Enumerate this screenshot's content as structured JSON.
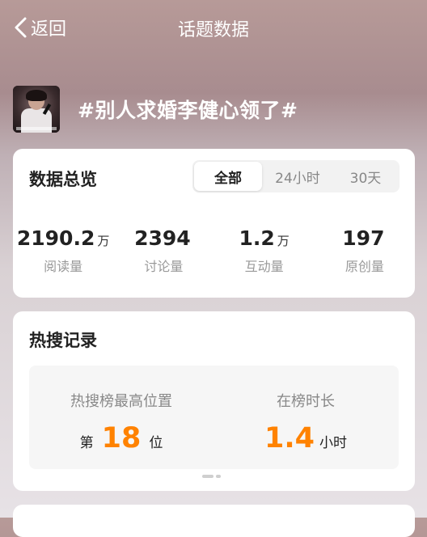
{
  "nav": {
    "back_label": "返回",
    "title": "话题数据"
  },
  "topic": {
    "name": "#别人求婚李健心领了#"
  },
  "overview": {
    "title": "数据总览",
    "tabs": [
      "全部",
      "24小时",
      "30天"
    ],
    "active_tab": "全部",
    "stats": [
      {
        "value": "2190.2",
        "unit": "万",
        "label": "阅读量"
      },
      {
        "value": "2394",
        "unit": "",
        "label": "讨论量"
      },
      {
        "value": "1.2",
        "unit": "万",
        "label": "互动量"
      },
      {
        "value": "197",
        "unit": "",
        "label": "原创量"
      }
    ]
  },
  "hot": {
    "title": "热搜记录",
    "peak": {
      "label": "热搜榜最高位置",
      "prefix": "第",
      "value": "18",
      "suffix": "位"
    },
    "duration": {
      "label": "在榜时长",
      "value": "1.4",
      "suffix": "小时"
    }
  },
  "colors": {
    "accent": "#ff8200",
    "card": "#ffffff"
  },
  "icons": {
    "back": "chevron-left-icon"
  }
}
